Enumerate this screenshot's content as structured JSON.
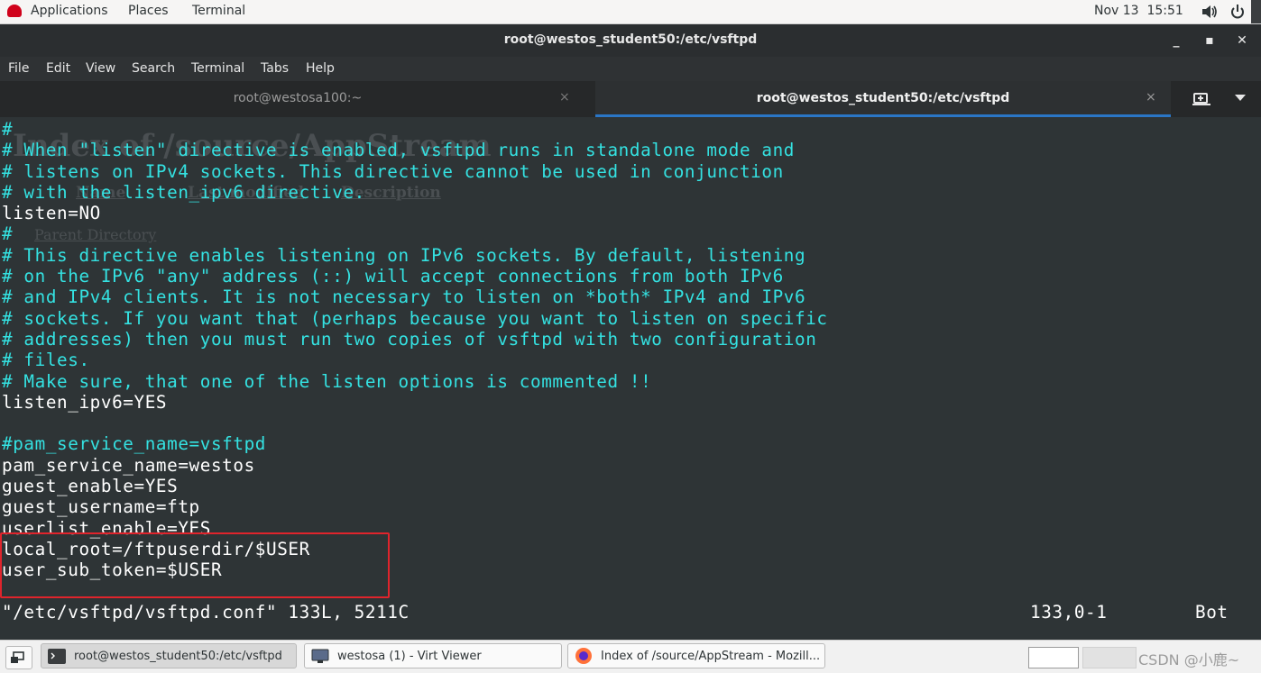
{
  "topbar": {
    "applications": "Applications",
    "places": "Places",
    "terminal": "Terminal",
    "datetime": "Nov 13  15:51"
  },
  "window": {
    "title": "root@westos_student50:/etc/vsftpd",
    "minimize": "_",
    "maximize": "▪",
    "close": "✕"
  },
  "menu": [
    "File",
    "Edit",
    "View",
    "Search",
    "Terminal",
    "Tabs",
    "Help"
  ],
  "tabs": [
    {
      "label": "root@westosa100:~",
      "close": "×"
    },
    {
      "label": "root@westos_student50:/etc/vsftpd",
      "close": "×"
    }
  ],
  "terminal": {
    "lines": [
      {
        "text": "#",
        "kind": "comment"
      },
      {
        "text": "# When \"listen\" directive is enabled, vsftpd runs in standalone mode and",
        "kind": "comment"
      },
      {
        "text": "# listens on IPv4 sockets. This directive cannot be used in conjunction",
        "kind": "comment"
      },
      {
        "text": "# with the listen_ipv6 directive.",
        "kind": "comment"
      },
      {
        "text": "listen=NO",
        "kind": "plain"
      },
      {
        "text": "#",
        "kind": "comment"
      },
      {
        "text": "# This directive enables listening on IPv6 sockets. By default, listening",
        "kind": "comment"
      },
      {
        "text": "# on the IPv6 \"any\" address (::) will accept connections from both IPv6",
        "kind": "comment"
      },
      {
        "text": "# and IPv4 clients. It is not necessary to listen on *both* IPv4 and IPv6",
        "kind": "comment"
      },
      {
        "text": "# sockets. If you want that (perhaps because you want to listen on specific",
        "kind": "comment"
      },
      {
        "text": "# addresses) then you must run two copies of vsftpd with two configuration",
        "kind": "comment"
      },
      {
        "text": "# files.",
        "kind": "comment"
      },
      {
        "text": "# Make sure, that one of the listen options is commented !!",
        "kind": "comment"
      },
      {
        "text": "listen_ipv6=YES",
        "kind": "plain"
      },
      {
        "text": "",
        "kind": "plain"
      },
      {
        "text": "#pam_service_name=vsftpd",
        "kind": "comment"
      },
      {
        "text": "pam_service_name=westos",
        "kind": "plain"
      },
      {
        "text": "guest_enable=YES",
        "kind": "plain"
      },
      {
        "text": "guest_username=ftp",
        "kind": "plain"
      },
      {
        "text": "userlist_enable=YES",
        "kind": "plain"
      },
      {
        "text": "local_root=/ftpuserdir/$USER",
        "kind": "plain"
      },
      {
        "text": "user_sub_token=$USER",
        "kind": "plain"
      }
    ],
    "status_file": "\"/etc/vsftpd/vsftpd.conf\" 133L, 5211C",
    "status_pos": "133,0-1",
    "status_scroll": "Bot"
  },
  "ghost_overlay": {
    "title": "Index of /source/AppStream",
    "name_col": "Name",
    "modified_col": "Last modified",
    "desc_col": "Description",
    "parent": "Parent Directory"
  },
  "taskbar": {
    "tasks": [
      {
        "label": "root@westos_student50:/etc/vsftpd",
        "icon": "terminal-icon"
      },
      {
        "label": "westosa (1) - Virt Viewer",
        "icon": "virt-viewer-icon"
      },
      {
        "label": "Index of /source/AppStream - Mozill...",
        "icon": "firefox-icon"
      }
    ],
    "watermark": "CSDN @小鹿~"
  },
  "colors": {
    "comment": "#34e2e2",
    "plain": "#ffffff",
    "highlight_box": "#e0242c",
    "tab_accent": "#2a76c6"
  }
}
